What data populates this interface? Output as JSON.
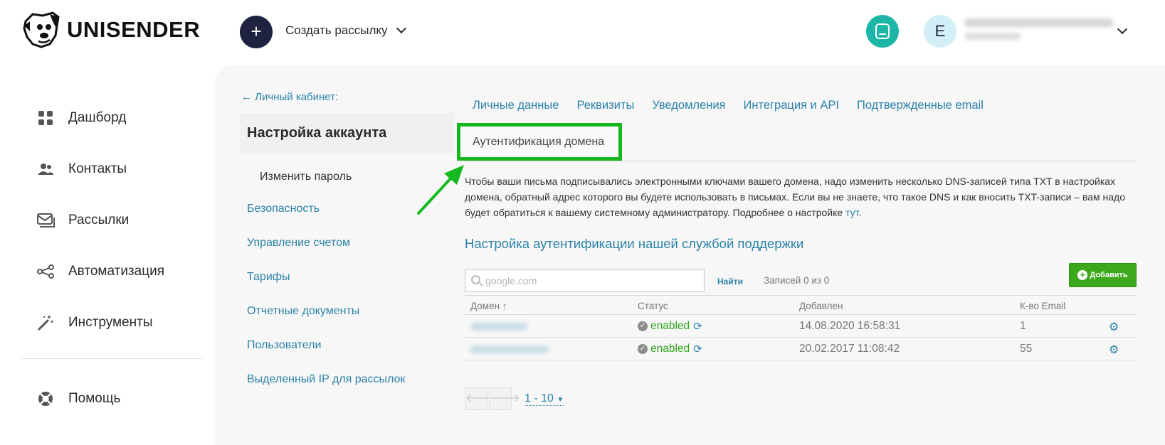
{
  "header": {
    "logo_text": "UNISENDER",
    "create_button_icon": "+",
    "create_label": "Создать рассылку",
    "avatar_letter": "E",
    "account_email": "",
    "account_id": ""
  },
  "left_nav": {
    "items": [
      {
        "label": "Дашборд",
        "icon": "grid-icon"
      },
      {
        "label": "Контакты",
        "icon": "users-icon"
      },
      {
        "label": "Рассылки",
        "icon": "mail-stack-icon"
      },
      {
        "label": "Автоматизация",
        "icon": "nodes-icon"
      },
      {
        "label": "Инструменты",
        "icon": "magic-wand-icon"
      }
    ],
    "help": {
      "label": "Помощь",
      "icon": "lifebuoy-icon"
    }
  },
  "sub_nav": {
    "back_link": "← Личный кабинет:",
    "title": "Настройка аккаунта",
    "child": "Изменить пароль",
    "links": [
      "Безопасность",
      "Управление счетом",
      "Тарифы",
      "Отчетные документы",
      "Пользователи",
      "Выделенный IP для рассылок"
    ]
  },
  "tabs": {
    "items": [
      "Личные данные",
      "Реквизиты",
      "Уведомления",
      "Интеграция и API",
      "Подтвержденные email"
    ],
    "active": "Аутентификация домена"
  },
  "description": {
    "text": "Чтобы ваши письма подписывались электронными ключами вашего домена, надо изменить несколько DNS-записей типа TXT в настройках домена, обратный адрес которого вы будете использовать в письмах. Если вы не знаете, что такое DNS и как вносить TXT-записи – вам надо будет обратиться к вашему системному администратору. Подробнее о настройке ",
    "link": "тут",
    "end": "."
  },
  "section_title": "Настройка аутентификации нашей службой поддержки",
  "search": {
    "placeholder": "google.com",
    "find_label": "Найти",
    "records_label": "Записей 0 из 0",
    "add_label": "Добавить"
  },
  "table": {
    "columns": [
      "Домен ↑",
      "Статус",
      "Добавлен",
      "К-во Email"
    ],
    "rows": [
      {
        "domain": "",
        "status": "enabled",
        "added": "14.08.2020 16:58:31",
        "count": "1"
      },
      {
        "domain": "",
        "status": "enabled",
        "added": "20.02.2017 11:08:42",
        "count": "55"
      }
    ]
  },
  "pagination": {
    "prev": "🡐",
    "next": "🡒",
    "range": "1 - 10"
  },
  "colors": {
    "accent": "#2b82a8",
    "highlight": "#16b81f",
    "add_button": "#3ea81c",
    "status_enabled": "#2ea51b"
  }
}
